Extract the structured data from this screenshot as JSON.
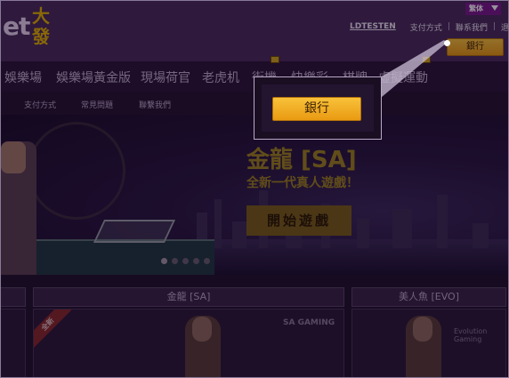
{
  "header": {
    "logo_text": "et",
    "logo_cn": "大發",
    "language": "繁体",
    "username": "LDTESTEN",
    "links": [
      "支付方式",
      "聯系我們",
      "退出"
    ],
    "bank_button": "銀行"
  },
  "nav": {
    "items": [
      "娛樂場",
      "娛樂場黃金版",
      "現場荷官",
      "老虎机",
      "街機",
      "快樂彩",
      "棋牌",
      "虛擬運動"
    ]
  },
  "subnav": {
    "items": [
      "支付方式",
      "常見問題",
      "聯繫我們"
    ]
  },
  "banner": {
    "title": "金龍 [SA]",
    "subtitle": "全新一代真人遊戲！",
    "play_button": "開始遊戲",
    "slide_count": 5,
    "active_slide": 0
  },
  "games": {
    "sections": [
      {
        "title": "金龍 [SA]",
        "badge": "全新",
        "provider": "SA GAMING"
      },
      {
        "title": "美人魚 [EVO]",
        "provider": "Evolution Gaming"
      }
    ]
  },
  "callout": {
    "bank_button": "銀行"
  },
  "colors": {
    "accent_gold": "#f5b52a",
    "header_purple": "#4a2c5c",
    "lang_badge": "#7a1a8c"
  }
}
